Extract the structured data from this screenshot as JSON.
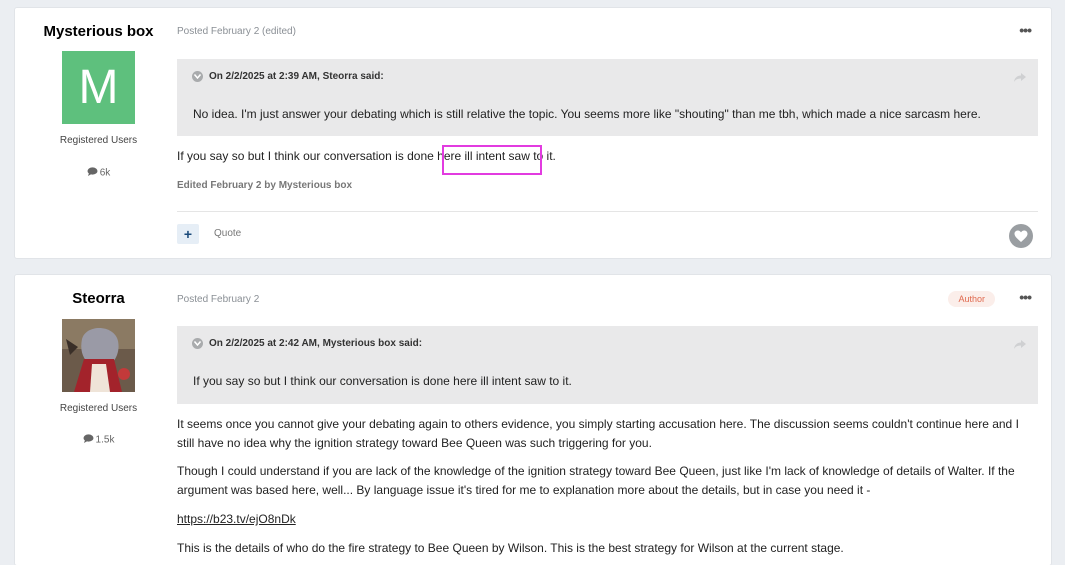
{
  "posts": [
    {
      "author": "Mysterious box",
      "avatar_letter": "M",
      "avatar_color": "#5ec07d",
      "group": "Registered Users",
      "count": "6k",
      "posted": "Posted February 2 (edited)",
      "quote_header": "On 2/2/2025 at 2:39 AM, Steorra said:",
      "quote_text": "No idea. I'm just answer your debating which is still relative the topic. You seems more like \"shouting\" than me tbh, which made a nice sarcasm here.",
      "body": "If you say so but I think our conversation is done here ill intent saw to it.",
      "edited": "Edited February 2 by Mysterious box",
      "quote_label": "Quote"
    },
    {
      "author": "Steorra",
      "group": "Registered Users",
      "count": "1.5k",
      "posted": "Posted February 2",
      "badge": "Author",
      "quote_header": "On 2/2/2025 at 2:42 AM, Mysterious box said:",
      "quote_text": "If you say so but I think our conversation is done here ill intent saw to it.",
      "para1": "It seems once you cannot give your debating again to others evidence, you simply starting accusation here. The discussion seems couldn't continue here and I still have no idea why the ignition strategy toward Bee Queen was such triggering for you.",
      "para2": "Though I could understand if you are lack of the knowledge of the ignition strategy toward Bee Queen, just like I'm lack of knowledge of details of Walter. If the argument was based here, well... By language issue it's tired for me to explanation more about the details, but in case you need it -",
      "link": "https://b23.tv/ejO8nDk",
      "para3": "This is the details of who do the fire strategy to Bee Queen by Wilson. This is the best strategy for Wilson at the current stage."
    }
  ],
  "accent": "#e23be0"
}
